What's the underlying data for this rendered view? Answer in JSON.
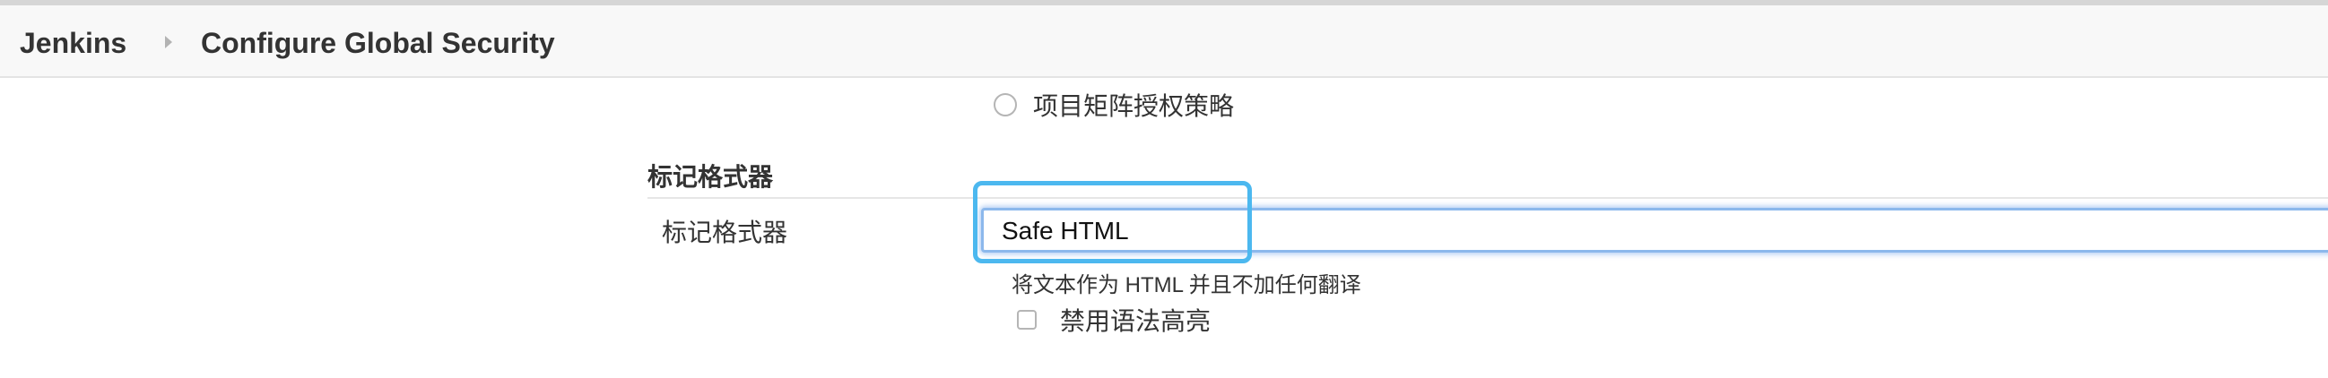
{
  "breadcrumb": {
    "home": "Jenkins",
    "separator_icon": "chevron-right-icon",
    "current": "Configure Global Security"
  },
  "authorization": {
    "radio_label": "项目矩阵授权策略",
    "selected": false
  },
  "markup_formatter": {
    "section_title": "标记格式器",
    "field_label": "标记格式器",
    "selected_value": "Safe HTML",
    "description": "将文本作为 HTML 并且不加任何翻译",
    "checkbox_label": "禁用语法高亮",
    "checkbox_checked": false
  },
  "colors": {
    "highlight": "#4cb8ef",
    "focus_glow": "#8cb8ec"
  }
}
